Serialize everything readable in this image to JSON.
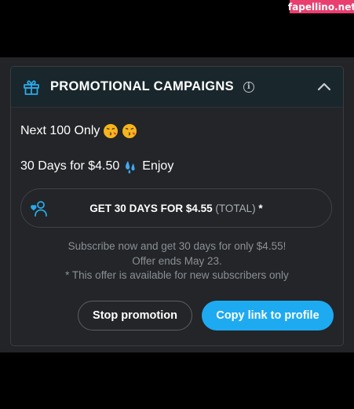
{
  "watermark": "fapellino.net",
  "header": {
    "title": "PROMOTIONAL CAMPAIGNS",
    "info_glyph": "i",
    "icon": "gift-icon",
    "accent": "#2aa9e8"
  },
  "promo": {
    "line1": "Next 100 Only",
    "line2_text": "30 Days for $4.50",
    "line2_suffix": "Enjoy",
    "emojis": [
      "kissing-face-icon",
      "kissing-face-icon",
      "sweat-droplets-icon"
    ]
  },
  "offer": {
    "main": "GET 30 DAYS FOR $4.55",
    "total": "(TOTAL)",
    "suffix": "*"
  },
  "description": {
    "line1": "Subscribe now and get 30 days for only $4.55!",
    "line2": "Offer ends May 23.",
    "line3": "* This offer is available for new subscribers only"
  },
  "buttons": {
    "stop": "Stop promotion",
    "copy": "Copy link to profile",
    "copy_color": "#1eaaf1"
  }
}
